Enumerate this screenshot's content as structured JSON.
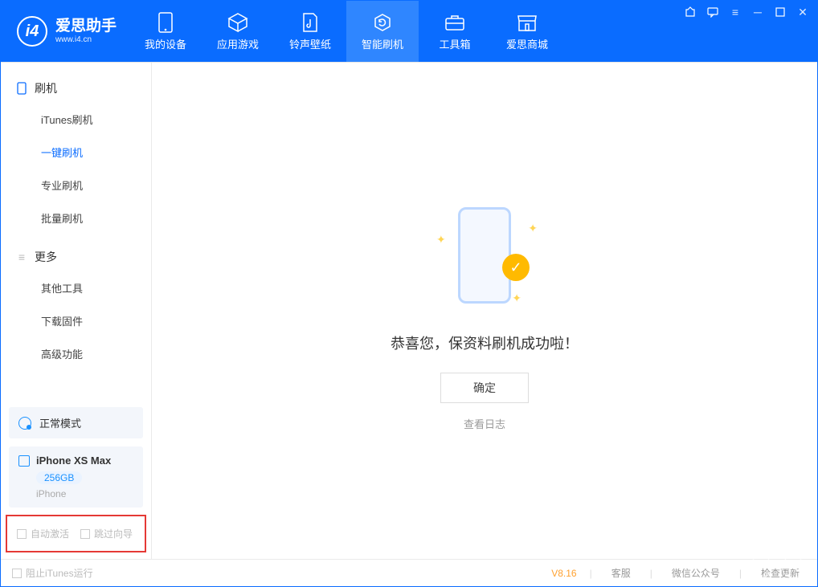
{
  "brand": {
    "name": "爱思助手",
    "url": "www.i4.cn"
  },
  "tabs": [
    {
      "label": "我的设备"
    },
    {
      "label": "应用游戏"
    },
    {
      "label": "铃声壁纸"
    },
    {
      "label": "智能刷机"
    },
    {
      "label": "工具箱"
    },
    {
      "label": "爱思商城"
    }
  ],
  "sidebar": {
    "group1_title": "刷机",
    "group1_items": [
      "iTunes刷机",
      "一键刷机",
      "专业刷机",
      "批量刷机"
    ],
    "group2_title": "更多",
    "group2_items": [
      "其他工具",
      "下载固件",
      "高级功能"
    ]
  },
  "device_mode": "正常模式",
  "device": {
    "name": "iPhone XS Max",
    "capacity": "256GB",
    "type": "iPhone"
  },
  "bottom_checks": {
    "auto_activate": "自动激活",
    "skip_guide": "跳过向导"
  },
  "main": {
    "success": "恭喜您，保资料刷机成功啦！",
    "ok": "确定",
    "view_log": "查看日志"
  },
  "status": {
    "block_itunes": "阻止iTunes运行",
    "version": "V8.16",
    "links": [
      "客服",
      "微信公众号",
      "检查更新"
    ]
  }
}
